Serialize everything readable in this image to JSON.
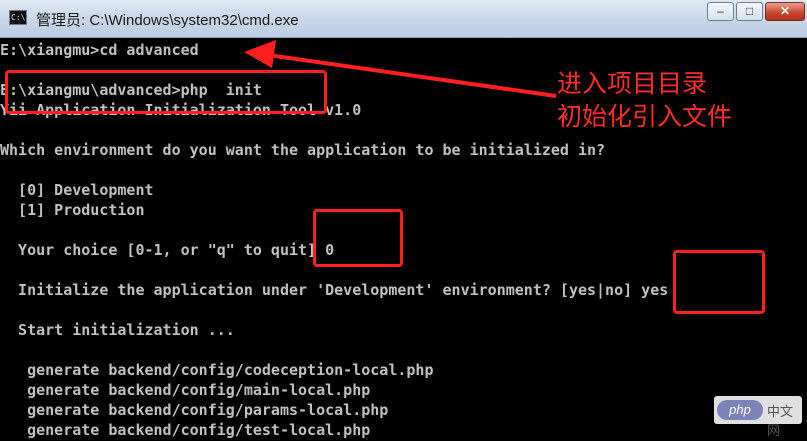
{
  "window": {
    "title": "管理员: C:\\Windows\\system32\\cmd.exe",
    "icon": "cmd-icon",
    "icon_label": "C:\\",
    "buttons": {
      "minimize": "–",
      "maximize": "□",
      "close": "✕"
    }
  },
  "console": {
    "lines": [
      "E:\\xiangmu>cd advanced",
      "",
      "E:\\xiangmu\\advanced>php  init",
      "Yii Application Initialization Tool v1.0",
      "",
      "Which environment do you want the application to be initialized in?",
      "",
      "  [0] Development",
      "  [1] Production",
      "",
      "  Your choice [0-1, or \"q\" to quit] 0",
      "",
      "  Initialize the application under 'Development' environment? [yes|no] yes",
      "",
      "  Start initialization ...",
      "",
      "   generate backend/config/codeception-local.php",
      "   generate backend/config/main-local.php",
      "   generate backend/config/params-local.php",
      "   generate backend/config/test-local.php"
    ]
  },
  "annotations": {
    "line1": "进入项目目录",
    "line2": "初始化引入文件",
    "color": "#ff1f1f"
  },
  "watermark": {
    "logo": "php",
    "text": "中文网"
  }
}
